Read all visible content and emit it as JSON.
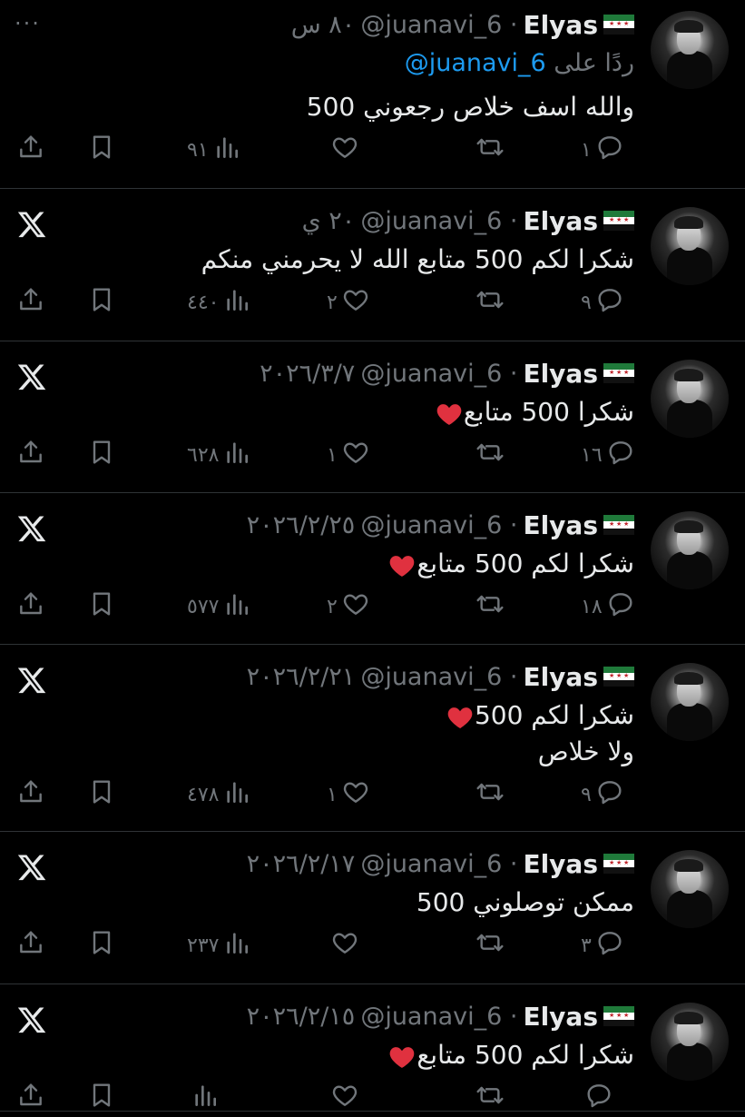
{
  "colors": {
    "background": "#000000",
    "text": "#e7e9ea",
    "muted": "#71767b",
    "link": "#1d9bf0",
    "divider": "#2f3336",
    "heart": "#e0313f"
  },
  "tweets": [
    {
      "name": "Elyas",
      "handle": "@juanavi_6 ·",
      "time": "٨٠ س",
      "reply_prefix": "ردًا على",
      "reply_handle": "@juanavi_6",
      "text": "والله اسف خلاص رجعوني 500",
      "has_heart": false,
      "corner_icon": "more-dots-icon",
      "corner_label": "···",
      "counts": {
        "reply": "١",
        "retweet": "",
        "like": "",
        "views": "٩١"
      }
    },
    {
      "name": "Elyas",
      "handle": "@juanavi_6 ·",
      "time": "٢٠ ي",
      "text": "شكرا لكم 500 متابع الله لا يحرمني منكم",
      "has_heart": false,
      "corner_icon": "x-logo-icon",
      "counts": {
        "reply": "٩",
        "retweet": "",
        "like": "٢",
        "views": "٤٤٠"
      }
    },
    {
      "name": "Elyas",
      "handle": "@juanavi_6 ·",
      "time": "٢٠٢٦/٣/٧",
      "text": "شكرا 500 متابع",
      "has_heart": true,
      "corner_icon": "x-logo-icon",
      "counts": {
        "reply": "١٦",
        "retweet": "",
        "like": "١",
        "views": "٦٢٨"
      }
    },
    {
      "name": "Elyas",
      "handle": "@juanavi_6 ·",
      "time": "٢٠٢٦/٢/٢٥",
      "text": "شكرا لكم 500 متابع",
      "has_heart": true,
      "corner_icon": "x-logo-icon",
      "counts": {
        "reply": "١٨",
        "retweet": "",
        "like": "٢",
        "views": "٥٧٧"
      }
    },
    {
      "name": "Elyas",
      "handle": "@juanavi_6 ·",
      "time": "٢٠٢٦/٢/٢١",
      "text": "شكرا لكم 500",
      "text2": "ولا خلاص",
      "has_heart": true,
      "corner_icon": "x-logo-icon",
      "counts": {
        "reply": "٩",
        "retweet": "",
        "like": "١",
        "views": "٤٧٨"
      }
    },
    {
      "name": "Elyas",
      "handle": "@juanavi_6 ·",
      "time": "٢٠٢٦/٢/١٧",
      "text": "ممكن توصلوني 500",
      "has_heart": false,
      "corner_icon": "x-logo-icon",
      "counts": {
        "reply": "٣",
        "retweet": "",
        "like": "",
        "views": "٢٣٧"
      }
    },
    {
      "name": "Elyas",
      "handle": "@juanavi_6 ·",
      "time": "٢٠٢٦/٢/١٥",
      "text": "شكرا لكم 500 متابع",
      "has_heart": true,
      "corner_icon": "x-logo-icon",
      "counts": {
        "reply": "",
        "retweet": "",
        "like": "",
        "views": ""
      }
    }
  ]
}
